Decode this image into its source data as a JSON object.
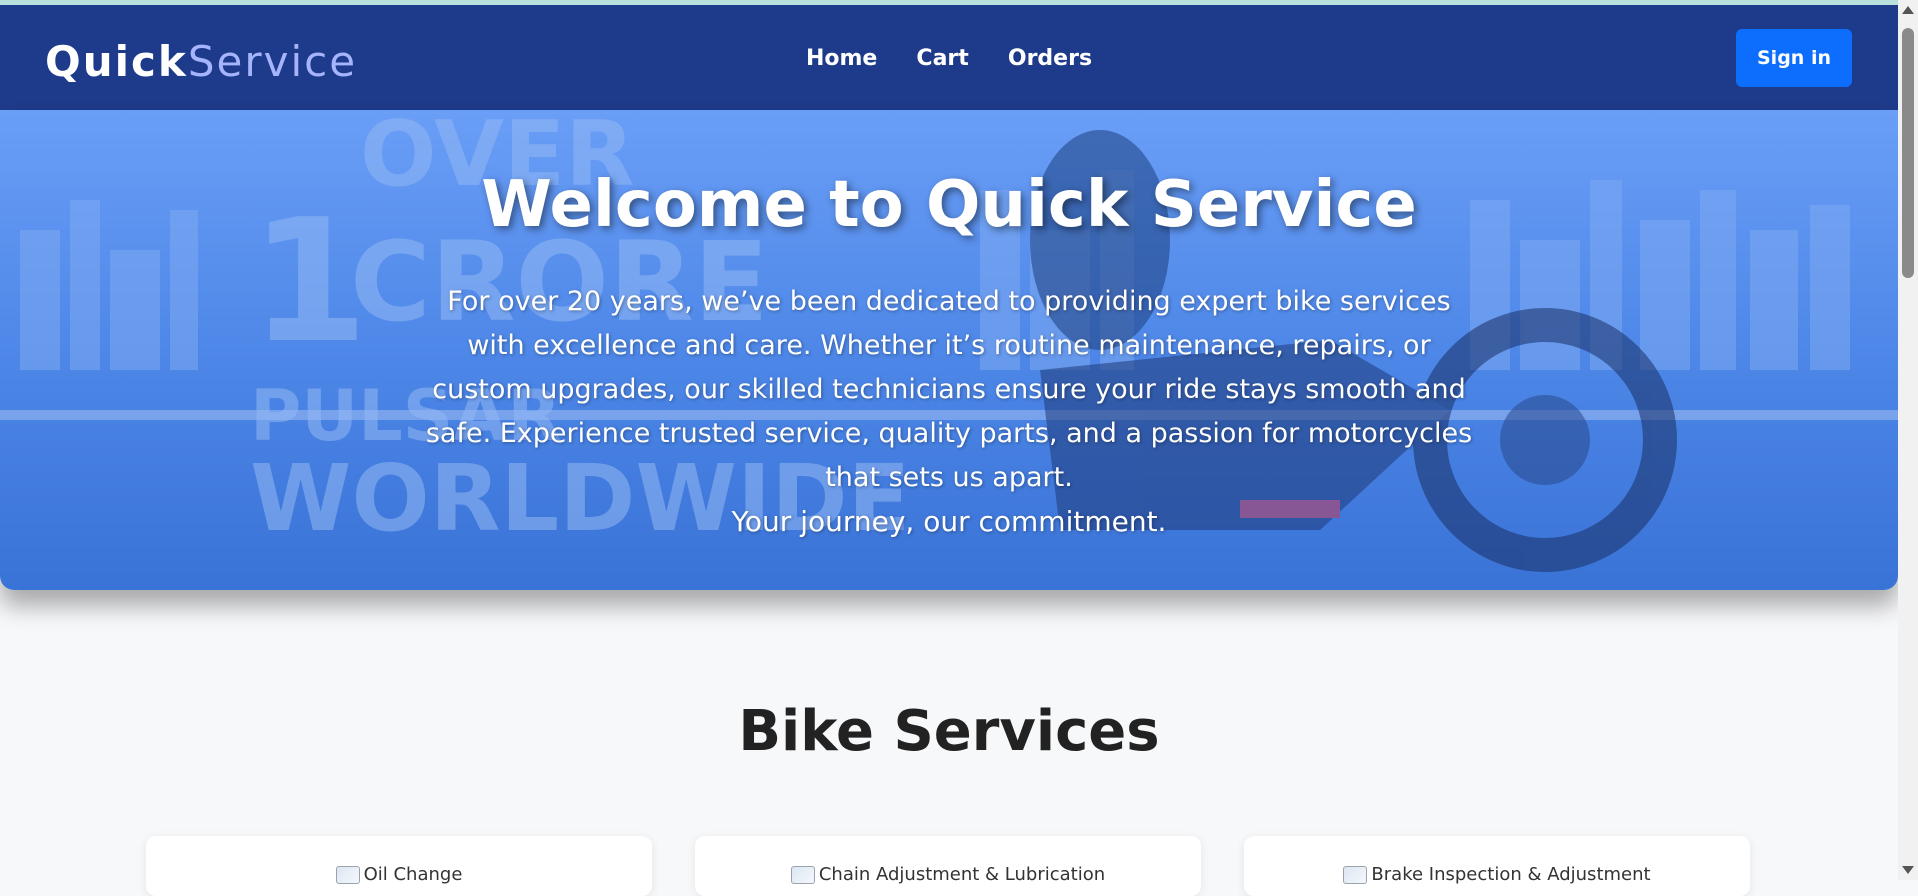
{
  "navbar": {
    "brand_primary": "Quick",
    "brand_secondary": "Service",
    "links": [
      "Home",
      "Cart",
      "Orders"
    ],
    "signin_label": "Sign in"
  },
  "hero": {
    "title": "Welcome to Quick Service",
    "description": "For over 20 years, we’ve been dedicated to providing expert bike services with excellence and care. Whether it’s routine maintenance, repairs, or custom upgrades, our skilled technicians ensure your ride stays smooth and safe. Experience trusted service, quality parts, and a passion for motorcycles that sets us apart.",
    "tagline": "Your journey, our commitment.",
    "background_overlay_text": [
      "OVER",
      "1",
      "CRORE",
      "PULSAR",
      "WORLDWIDE"
    ]
  },
  "services": {
    "title": "Bike Services",
    "cards": [
      {
        "image_alt": "Oil Change"
      },
      {
        "image_alt": "Chain Adjustment & Lubrication"
      },
      {
        "image_alt": "Brake Inspection & Adjustment"
      }
    ]
  },
  "colors": {
    "navbar_bg": "#1e3a8a",
    "brand_accent": "#a5b4fc",
    "signin_bg": "#0d6efd",
    "hero_overlay": "#4b85e6",
    "page_bg": "#f7f8fa"
  }
}
